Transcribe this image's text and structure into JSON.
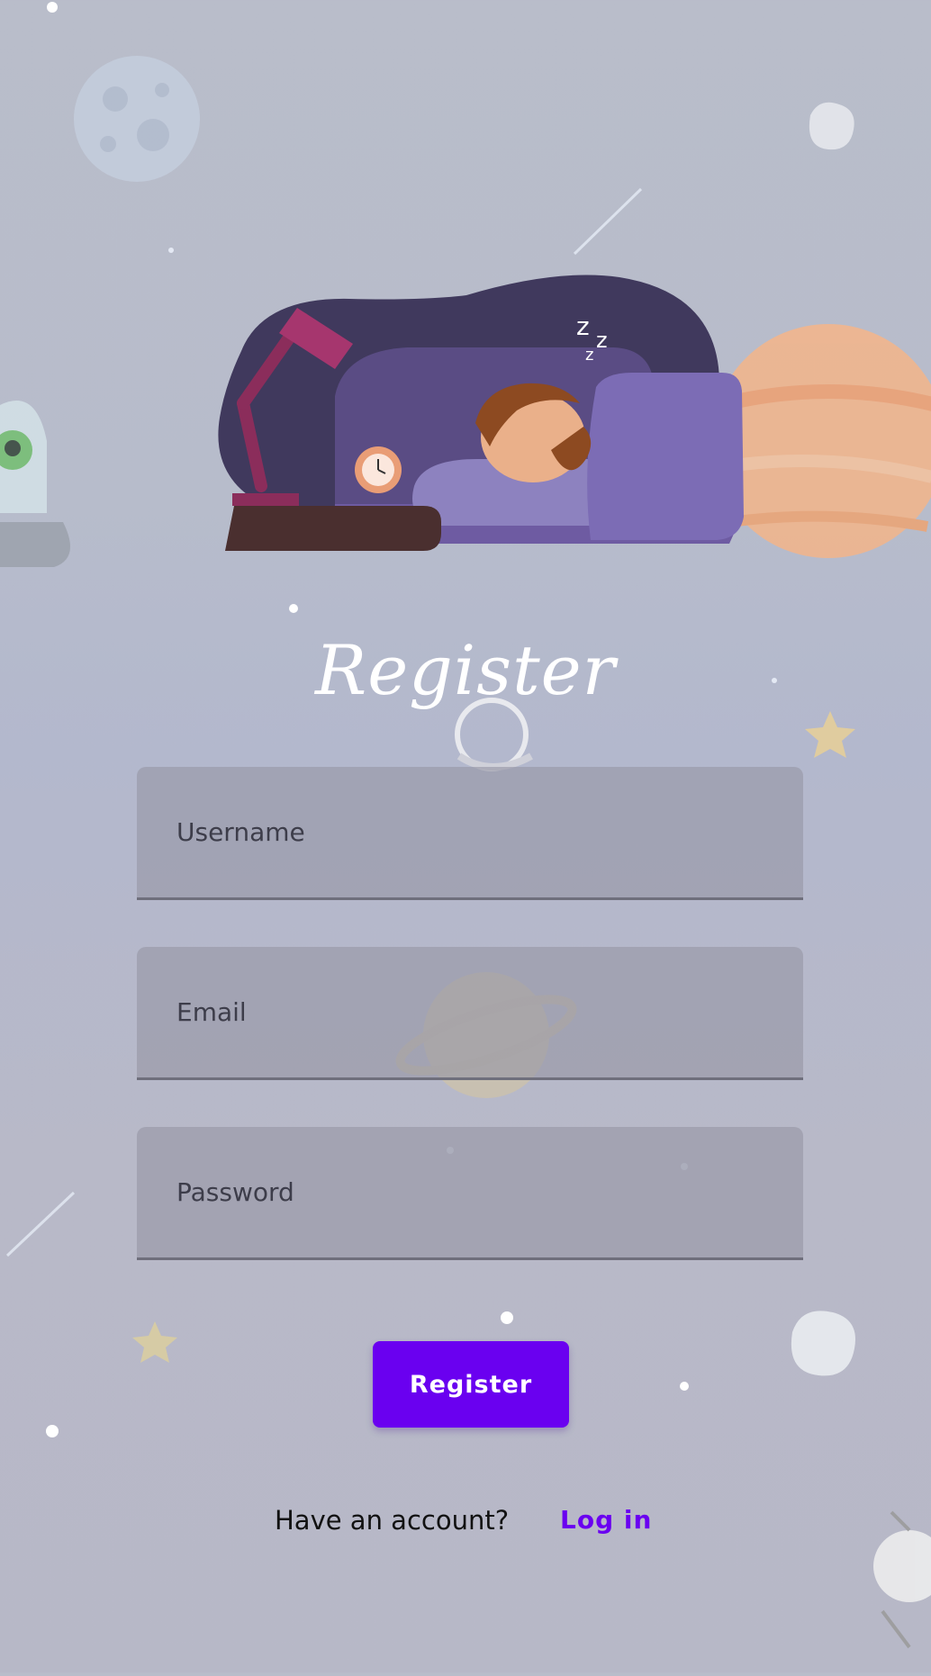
{
  "title": "Register",
  "form": {
    "username_placeholder": "Username",
    "email_placeholder": "Email",
    "password_placeholder": "Password",
    "submit_label": "Register"
  },
  "footer": {
    "prompt": "Have an account?",
    "login_link": "Log in"
  },
  "colors": {
    "accent": "#6a00f0",
    "background": "#b8bccb",
    "field_fill": "#9e9fae"
  },
  "icons": [
    "moon-icon",
    "asteroid-icon",
    "planet-icon",
    "ringed-planet-icon",
    "alien-icon",
    "star-icon",
    "shooting-star-icon",
    "satellite-icon"
  ]
}
